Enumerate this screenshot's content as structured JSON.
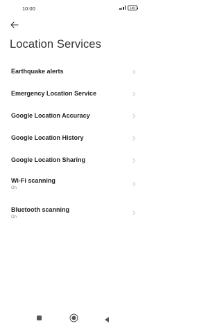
{
  "status_bar": {
    "time": "10:00",
    "battery": "100"
  },
  "header": {
    "title": "Location Services"
  },
  "items": [
    {
      "label": "Earthquake alerts",
      "sub": ""
    },
    {
      "label": "Emergency Location Service",
      "sub": ""
    },
    {
      "label": "Google Location Accuracy",
      "sub": ""
    },
    {
      "label": "Google Location History",
      "sub": ""
    },
    {
      "label": "Google Location Sharing",
      "sub": ""
    },
    {
      "label": "Wi-Fi scanning",
      "sub": "On"
    },
    {
      "label": "Bluetooth scanning",
      "sub": "On"
    }
  ],
  "icons": {
    "back": "arrow-left-icon",
    "chevron": "chevron-right-icon",
    "recents": "square-icon",
    "home": "circle-icon",
    "nav_back": "triangle-left-icon"
  },
  "colors": {
    "background": "#ffffff",
    "text": "#222222",
    "subtext": "#8a8a8a",
    "chevron": "#b8b8b8"
  }
}
